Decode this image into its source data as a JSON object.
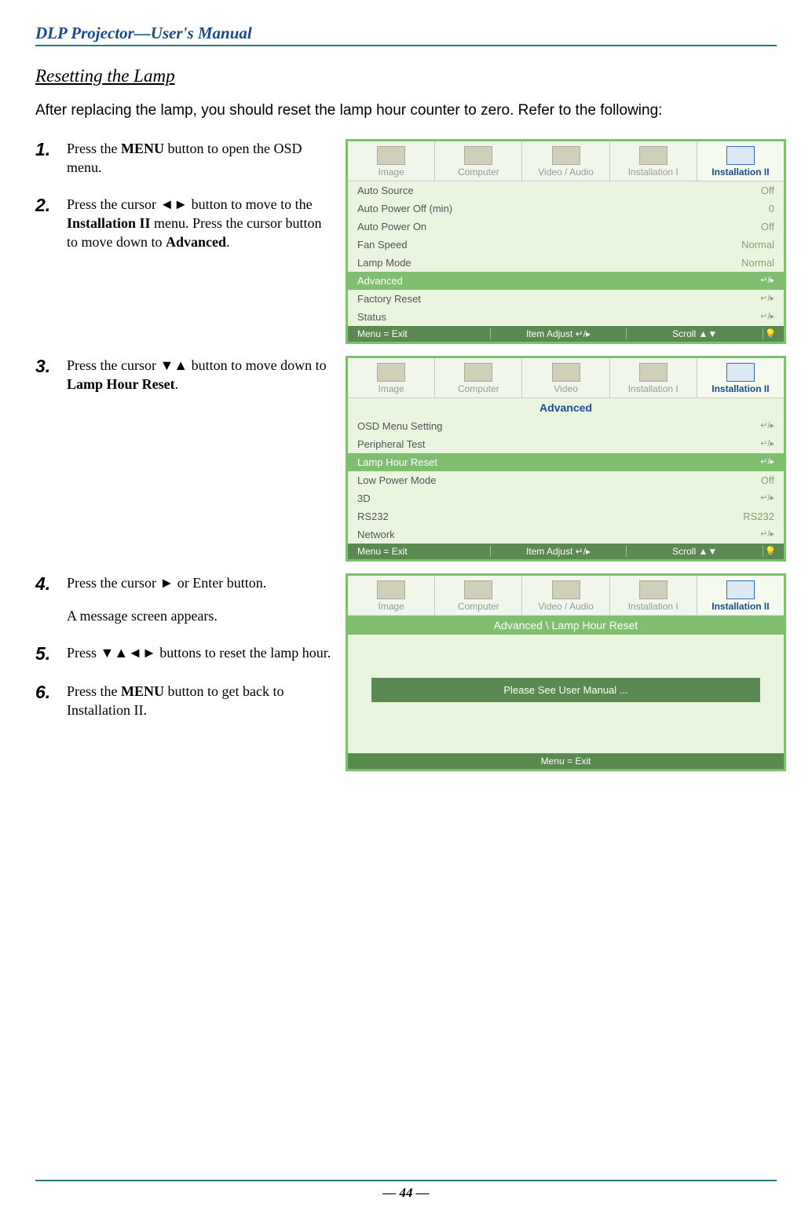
{
  "header": "DLP Projector—User's Manual",
  "section_title": "Resetting the Lamp",
  "intro": "After replacing the lamp, you should reset the lamp hour counter to zero. Refer to the following:",
  "steps": {
    "s1": {
      "num": "1.",
      "pre": "Press the ",
      "b1": "MENU",
      "post": " button to open the OSD menu."
    },
    "s2": {
      "num": "2.",
      "pre": "Press the cursor ◄► button to move to the ",
      "b1": "Installation II",
      "mid": " menu. Press the cursor  button to move down to ",
      "b2": "Advanced",
      "post": "."
    },
    "s3": {
      "num": "3.",
      "pre": "Press the cursor ▼▲ button to move down to ",
      "b1": "Lamp Hour Reset",
      "post": "."
    },
    "s4": {
      "num": "4.",
      "pre": "Press the cursor ► or Enter button.",
      "post2": "A message screen appears."
    },
    "s5": {
      "num": "5.",
      "pre": "Press ▼▲◄► buttons to reset the lamp hour."
    },
    "s6": {
      "num": "6.",
      "pre": "Press the ",
      "b1": "MENU",
      "post": " button to get back to Installation II."
    }
  },
  "osd1": {
    "tabs": [
      "Image",
      "Computer",
      "Video / Audio",
      "Installation I",
      "Installation II"
    ],
    "items": [
      {
        "label": "Auto Source",
        "val": "Off"
      },
      {
        "label": "Auto Power Off (min)",
        "val": "0"
      },
      {
        "label": "Auto Power On",
        "val": "Off"
      },
      {
        "label": "Fan Speed",
        "val": "Normal"
      },
      {
        "label": "Lamp Mode",
        "val": "Normal"
      },
      {
        "label": "Advanced",
        "val": "↵/▸",
        "selected": true
      },
      {
        "label": "Factory Reset",
        "val": "↵/▸"
      },
      {
        "label": "Status",
        "val": "↵/▸"
      }
    ],
    "status": {
      "exit": "Menu = Exit",
      "adjust": "Item Adjust ↵/▸",
      "scroll": "Scroll ▲▼",
      "bulb": "💡"
    }
  },
  "osd2": {
    "tabs": [
      "Image",
      "Computer",
      "Video",
      "Installation I",
      "Installation II"
    ],
    "title": "Advanced",
    "items": [
      {
        "label": "OSD Menu Setting",
        "val": "↵/▸"
      },
      {
        "label": "Peripheral Test",
        "val": "↵/▸"
      },
      {
        "label": "Lamp Hour Reset",
        "val": "↵/▸",
        "selected": true
      },
      {
        "label": "Low Power Mode",
        "val": "Off"
      },
      {
        "label": "3D",
        "val": "↵/▸"
      },
      {
        "label": "RS232",
        "val": "RS232"
      },
      {
        "label": "Network",
        "val": "↵/▸"
      }
    ],
    "status": {
      "exit": "Menu = Exit",
      "adjust": "Item Adjust ↵/▸",
      "scroll": "Scroll ▲▼",
      "bulb": "💡"
    }
  },
  "osd3": {
    "tabs": [
      "Image",
      "Computer",
      "Video / Audio",
      "Installation I",
      "Installation II"
    ],
    "crumb": "Advanced \\ Lamp Hour Reset",
    "message": "Please See User Manual ...",
    "exit": "Menu = Exit"
  },
  "page_num": "— 44 —"
}
